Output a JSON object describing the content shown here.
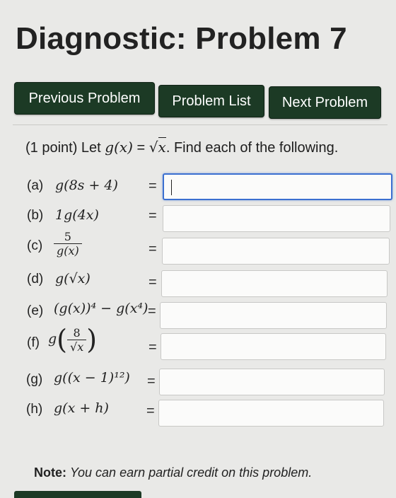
{
  "title": "Diagnostic: Problem 7",
  "nav": {
    "previous": "Previous Problem",
    "list": "Problem List",
    "next": "Next Problem"
  },
  "problem": {
    "points": "(1 point) Let",
    "function_lhs": "g(x)",
    "equals": "=",
    "radicand": "x",
    "instruction": ". Find each of the following."
  },
  "parts": [
    {
      "label": "(a)",
      "expr": "g(8s + 4)",
      "value": ""
    },
    {
      "label": "(b)",
      "expr": "1g(4x)",
      "value": ""
    },
    {
      "label": "(c)",
      "expr_num": "5",
      "expr_den": "g(x)",
      "value": ""
    },
    {
      "label": "(d)",
      "expr": "g(√x)",
      "value": ""
    },
    {
      "label": "(e)",
      "expr": "(g(x))⁴ − g(x⁴)",
      "value": ""
    },
    {
      "label": "(f)",
      "expr_num": "8",
      "expr_den": "√x",
      "value": ""
    },
    {
      "label": "(g)",
      "expr": "g((x − 1)¹²)",
      "value": ""
    },
    {
      "label": "(h)",
      "expr": "g(x + h)",
      "value": ""
    }
  ],
  "eq_sign": "=",
  "note": {
    "label": "Note:",
    "text": "You can earn partial credit on this problem."
  },
  "colors": {
    "button_bg": "#1c3a25",
    "page_bg": "#e9e9e7",
    "focus": "#3b6fd0"
  }
}
